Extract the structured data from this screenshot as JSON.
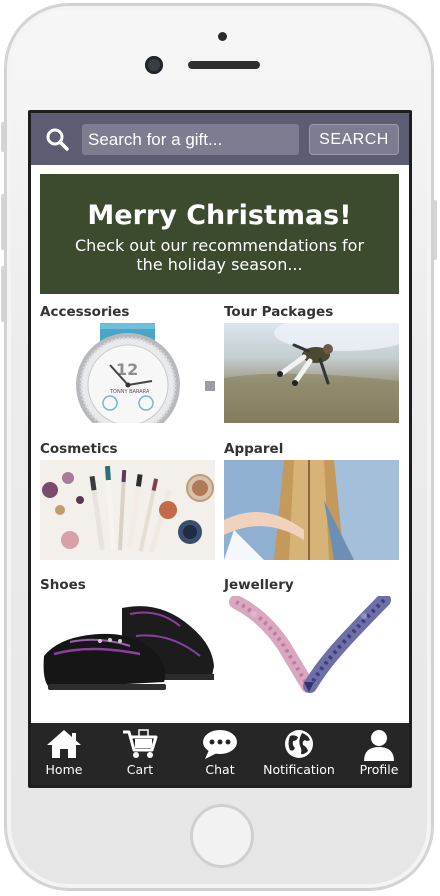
{
  "search": {
    "placeholder": "Search for a gift...",
    "button_label": "SEARCH",
    "icon": "search-icon"
  },
  "banner": {
    "title": "Merry Christmas!",
    "subtitle": "Check out our recommendations for the holiday season...",
    "color": "#3c4a2e"
  },
  "categories": [
    {
      "label": "Accessories",
      "image": "watch"
    },
    {
      "label": "Tour Packages",
      "image": "skydiver"
    },
    {
      "label": "Cosmetics",
      "image": "makeup-brushes"
    },
    {
      "label": "Apparel",
      "image": "couple-jacket"
    },
    {
      "label": "Shoes",
      "image": "bowling-shoes"
    },
    {
      "label": "Jewellery",
      "image": "necklace"
    }
  ],
  "tabs": [
    {
      "label": "Home",
      "icon": "home-icon"
    },
    {
      "label": "Cart",
      "icon": "cart-icon"
    },
    {
      "label": "Chat",
      "icon": "chat-icon"
    },
    {
      "label": "Notification",
      "icon": "globe-icon"
    },
    {
      "label": "Profile",
      "icon": "profile-icon"
    }
  ],
  "colors": {
    "search_bar": "#5c5c72",
    "tab_bar": "#262626"
  }
}
